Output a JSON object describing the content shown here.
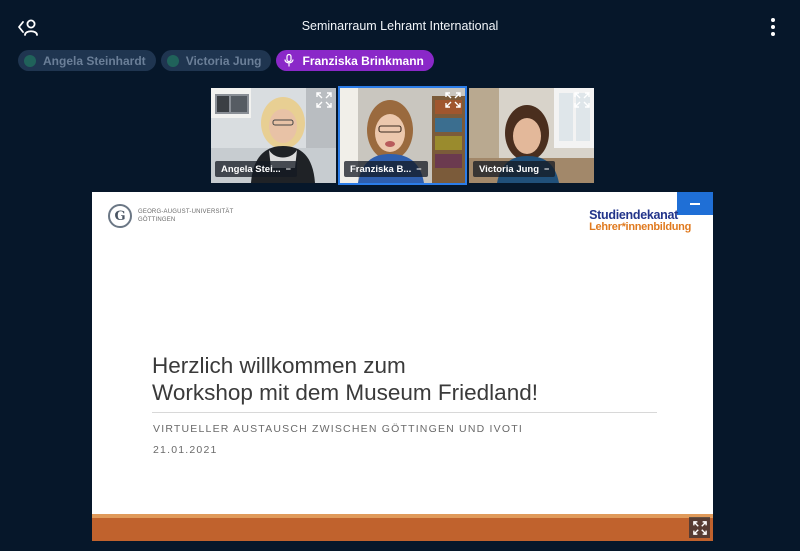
{
  "header": {
    "title": "Seminarraum Lehramt International",
    "user_list_icon": "user-list-toggle-icon",
    "options_icon": "more-vertical-icon"
  },
  "talkers": [
    {
      "name": "Angela Steinhardt",
      "active": false
    },
    {
      "name": "Victoria Jung",
      "active": false
    },
    {
      "name": "Franziska Brinkmann",
      "active": true
    }
  ],
  "videos": [
    {
      "name": "Angela Stei...",
      "active": false
    },
    {
      "name": "Franziska B...",
      "active": true
    },
    {
      "name": "Victoria Jung",
      "active": false
    }
  ],
  "slide": {
    "uni_line1": "GEORG-AUGUST-UNIVERSITÄT",
    "uni_line2": "GÖTTINGEN",
    "dekanat_line1": "Studiendekanat",
    "dekanat_line2": "Lehrer*innenbildung",
    "title_line1": "Herzlich willkommen zum",
    "title_line2": "Workshop mit dem Museum Friedland!",
    "subtitle": "VIRTUELLER AUSTAUSCH ZWISCHEN GÖTTINGEN UND IVOTI",
    "date": "21.01.2021"
  },
  "colors": {
    "background": "#06172a",
    "active_talker": "#8a28c8",
    "active_video_border": "#2b7de9",
    "minimize_button": "#1f6fd6",
    "slide_footer": "#c0622d"
  }
}
